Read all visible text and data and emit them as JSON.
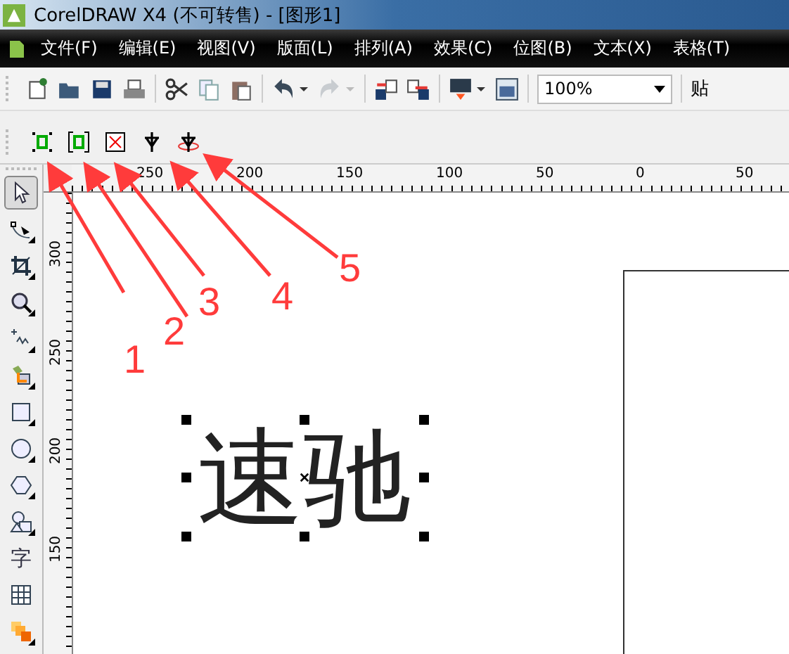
{
  "window": {
    "title": "CorelDRAW X4 (不可转售) - [图形1]"
  },
  "menu": [
    "文件(F)",
    "编辑(E)",
    "视图(V)",
    "版面(L)",
    "排列(A)",
    "效果(C)",
    "位图(B)",
    "文本(X)",
    "表格(T)"
  ],
  "toolbar": {
    "zoom": "100%",
    "cut_label": "贴"
  },
  "ruler_h": [
    "250",
    "200",
    "150",
    "100",
    "50",
    "0",
    "50"
  ],
  "ruler_v": [
    "300",
    "250",
    "200",
    "150"
  ],
  "toolbox": [
    {
      "kind": "pick",
      "selected": true
    },
    {
      "kind": "shape",
      "selected": false
    },
    {
      "kind": "crop",
      "selected": false
    },
    {
      "kind": "zoom",
      "selected": false
    },
    {
      "kind": "freehand",
      "selected": false
    },
    {
      "kind": "smartfill",
      "selected": false
    },
    {
      "kind": "rect",
      "selected": false
    },
    {
      "kind": "ellipse",
      "selected": false
    },
    {
      "kind": "polygon",
      "selected": false
    },
    {
      "kind": "shapes",
      "selected": false
    },
    {
      "kind": "text",
      "label": "字",
      "selected": false
    },
    {
      "kind": "table",
      "selected": false
    },
    {
      "kind": "blend",
      "selected": false
    }
  ],
  "canvas": {
    "text": "速驰"
  },
  "callouts": [
    "1",
    "2",
    "3",
    "4",
    "5"
  ]
}
